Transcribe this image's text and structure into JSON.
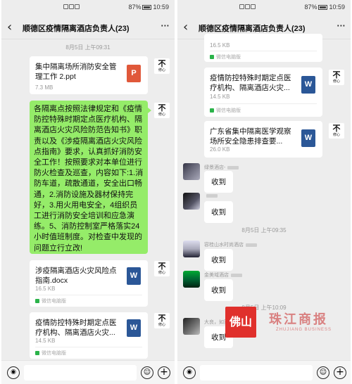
{
  "status": {
    "battery": "87%",
    "time": "10:59"
  },
  "chat": {
    "title": "顺德区疫情隔离酒店负责人(23)",
    "back": "‹",
    "more": "···"
  },
  "left": {
    "timestamp": "8月5日 上午09:31",
    "file1": {
      "name": "集中隔离场所消防安全管理工作 2.ppt",
      "size": "7.3 MB",
      "icon": "P"
    },
    "message": "各隔离点按照法律规定和《疫情防控特殊时期定点医疗机构、隔离酒店火灾风险防范告知书》职责以及《涉疫隔离酒店火灾风险点指南》要求，认真抓好消防安全工作！按照要求对本单位进行防火检查及巡查，内容如下:1.消防车道，疏散通道，安全出口畅通，2.消防设施及器材保持完好，3.用火用电安全，4组织员工进行消防安全培训和应急演练。5、消防控制室严格落实24小时值班制度。对检查中发现的问题立行立改!",
    "file2": {
      "name": "涉疫隔离酒店火灾风险点指南.docx",
      "size": "16.5 KB",
      "icon": "W",
      "source": "微信电脑版"
    },
    "file3": {
      "name": "疫情防控特殊时期定点医疗机构、隔离酒店火灾...",
      "size": "14.5 KB",
      "icon": "W",
      "source": "微信电脑版"
    },
    "avatar": {
      "line1": "不",
      "line2": "修心"
    }
  },
  "right": {
    "top_size": "16.5 KB",
    "top_source": "微信电脑版",
    "file4": {
      "name": "疫情防控特殊时期定点医疗机构、隔离酒店火灾...",
      "size": "14.5 KB",
      "icon": "W",
      "source": "微信电脑版"
    },
    "file5": {
      "name": "广东省集中隔离医学观察场所安全隐患排查要...",
      "size": "26.0 KB",
      "icon": "W"
    },
    "replies": [
      {
        "sender": "绿景酒店-",
        "text": "收到"
      },
      {
        "sender": "",
        "text": "收到"
      },
      {
        "sender": "容桂山水时尚酒店",
        "text": "收到"
      },
      {
        "sender": "金美域酒店",
        "text": "收到"
      },
      {
        "sender": "大良，如家酒店",
        "text": "收到"
      }
    ],
    "timestamp1": "8月5日 上午09:35",
    "timestamp2": "8月5日 上午10:09"
  },
  "watermark": {
    "brand": "佛山",
    "name": "珠江商报",
    "sub": "ZHUJIANG BUSINESS"
  }
}
